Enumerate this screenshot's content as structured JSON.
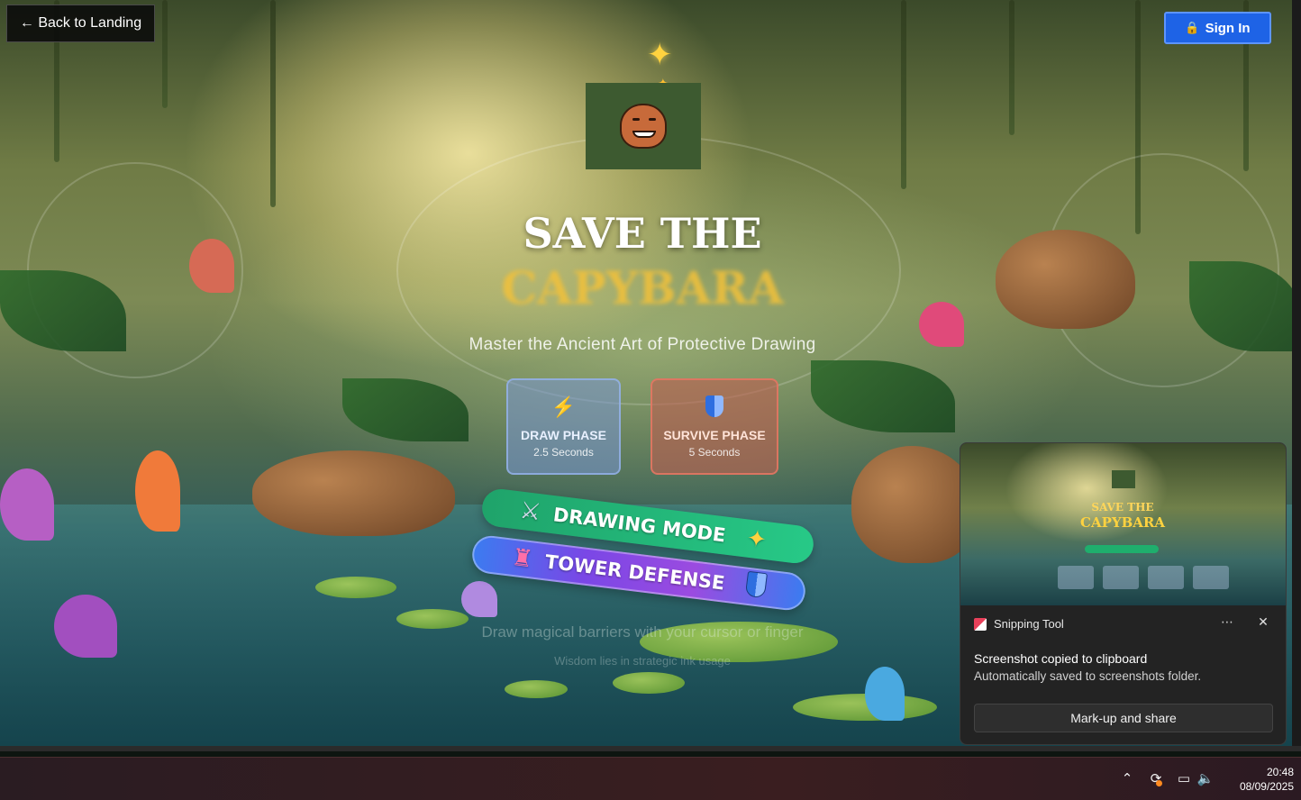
{
  "nav": {
    "back_label": "← Back to Landing",
    "signin_label": "Sign In",
    "signin_icon": "lock-icon"
  },
  "hero": {
    "title_line1": "SAVE THE",
    "title_line2": "CAPYBARA",
    "subtitle": "Master the Ancient Art of Protective Drawing"
  },
  "phases": [
    {
      "name": "DRAW PHASE",
      "time": "2.5 Seconds",
      "icon": "lightning-bolt-icon"
    },
    {
      "name": "SURVIVE PHASE",
      "time": "5 Seconds",
      "icon": "shield-icon"
    }
  ],
  "modes": [
    {
      "label": "DRAWING MODE",
      "lead_icon": "crossed-swords-icon",
      "trail_icon": "sparkles-icon"
    },
    {
      "label": "TOWER DEFENSE",
      "lead_icon": "castle-icon",
      "trail_icon": "shield-icon"
    }
  ],
  "hints": {
    "line1": "Draw magical barriers with your cursor or finger",
    "line2": "Wisdom lies in strategic ink usage"
  },
  "toast": {
    "app_name": "Snipping Tool",
    "message": "Screenshot copied to clipboard",
    "detail": "Automatically saved to screenshots folder.",
    "action_label": "Mark-up and share",
    "thumb_title1": "SAVE THE",
    "thumb_title2": "CAPYBARA"
  },
  "taskbar": {
    "time": "20:48",
    "date": "08/09/2025"
  },
  "colors": {
    "signin_bg": "#1e63e6",
    "title_gold": "#f2c13a",
    "drawing_mode_green": "#1fa36a",
    "tower_defense_purple": "#7a47e6"
  }
}
